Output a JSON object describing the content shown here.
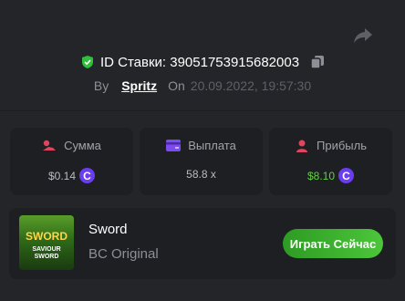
{
  "bet": {
    "id_label": "ID Ставки: 39051753915682003"
  },
  "author": {
    "by_label": "By",
    "username": "Spritz",
    "on_label": "On",
    "datetime": "20.09.2022, 19:57:30"
  },
  "stats": [
    {
      "label": "Сумма",
      "value": "$0.14",
      "coin": "C",
      "color": "#b9bcc2"
    },
    {
      "label": "Выплата",
      "value": "58.8 x",
      "color": "#b9bcc2"
    },
    {
      "label": "Прибыль",
      "value": "$8.10",
      "coin": "C",
      "color": "#5fd33b"
    }
  ],
  "game": {
    "name": "Sword",
    "provider": "BC Original",
    "thumb_title": "SWORD",
    "thumb_sub": "SAVIOUR SWORD",
    "play_label": "Играть Сейчас"
  },
  "colors": {
    "accent_green": "#3fb62e",
    "coin_purple": "#6a3df0",
    "shield_green": "#2fbf3a"
  }
}
